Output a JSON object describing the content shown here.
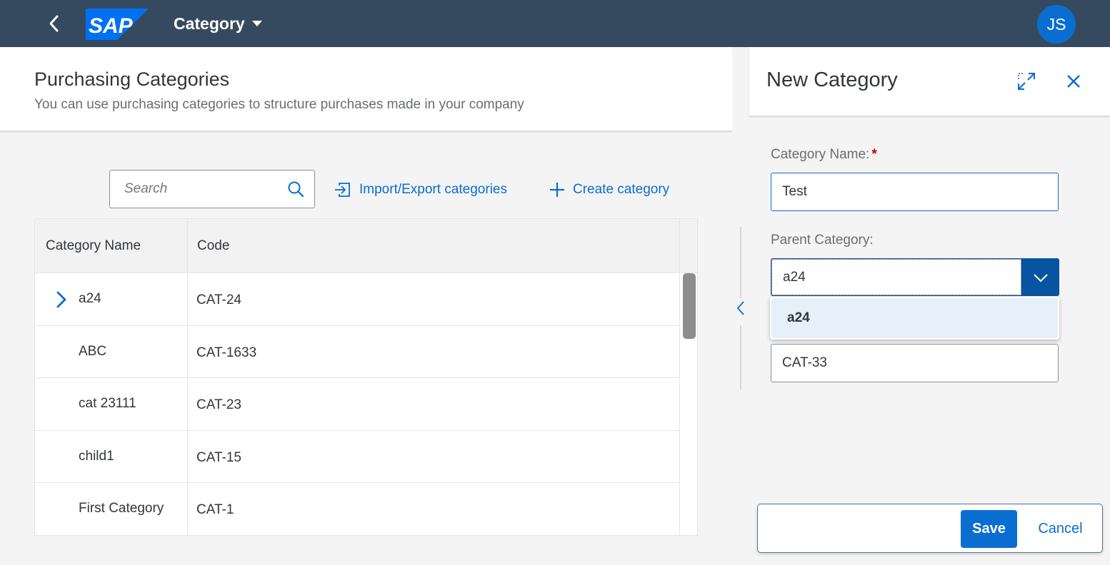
{
  "shell": {
    "logo_text": "SAP",
    "app_title": "Category",
    "avatar_initials": "JS",
    "colors": {
      "shell_bg": "#354a5f",
      "avatar_bg": "#0a6ed1",
      "logo_blue": "#0070f2"
    }
  },
  "page": {
    "title": "Purchasing Categories",
    "subtitle": "You can use purchasing categories to structure purchases made in your company"
  },
  "toolbar": {
    "search_placeholder": "Search",
    "import_export_label": "Import/Export categories",
    "create_label": "Create category"
  },
  "table": {
    "columns": [
      "Category Name",
      "Code"
    ],
    "rows": [
      {
        "name": "a24",
        "code": "CAT-24",
        "expandable": true
      },
      {
        "name": "ABC",
        "code": "CAT-1633",
        "expandable": false
      },
      {
        "name": "cat 23111",
        "code": "CAT-23",
        "expandable": false
      },
      {
        "name": "child1",
        "code": "CAT-15",
        "expandable": false
      },
      {
        "name": "First Category",
        "code": "CAT-1",
        "expandable": false
      }
    ]
  },
  "panel": {
    "title": "New Category",
    "category_name_label": "Category Name:",
    "required_mark": "*",
    "category_name_value": "Test",
    "parent_category_label": "Parent Category:",
    "parent_category_value": "a24",
    "dropdown_options": [
      "a24"
    ],
    "code_value": "CAT-33",
    "save_label": "Save",
    "cancel_label": "Cancel"
  },
  "colors": {
    "accent": "#0a6ed1",
    "dark_accent": "#0854a0",
    "required": "#bb0000"
  }
}
